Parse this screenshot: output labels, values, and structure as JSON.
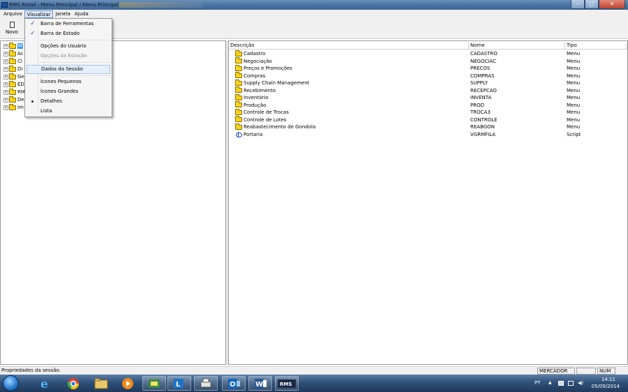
{
  "window": {
    "title": "RMS Retail - Menu Principal / Menu Principal",
    "minimize_glyph": "–",
    "maximize_glyph": "□",
    "close_glyph": "✕"
  },
  "menubar": {
    "items": [
      "Arquivo",
      "Visualizar",
      "Janela",
      "Ajuda"
    ],
    "active": "Visualizar"
  },
  "toolbar": {
    "new_label": "Novo"
  },
  "view_menu": {
    "items": [
      {
        "label": "Barra de Ferramentas",
        "mark": "✓",
        "enabled": true
      },
      {
        "label": "Barra de Estado",
        "mark": "✓",
        "enabled": true
      },
      {
        "label": "Opções do Usuário",
        "mark": "",
        "enabled": true
      },
      {
        "label": "Opções da Estação",
        "mark": "",
        "enabled": false
      },
      {
        "label": "Dados da Sessão",
        "mark": "",
        "enabled": true,
        "highlighted": true
      },
      {
        "label": "Ícones Pequenos",
        "mark": "",
        "enabled": true
      },
      {
        "label": "Ícones Grandes",
        "mark": "",
        "enabled": true
      },
      {
        "label": "Detalhes",
        "mark": "bullet",
        "enabled": true
      },
      {
        "label": "Lista",
        "mark": "",
        "enabled": true
      }
    ]
  },
  "tree": {
    "expand_glyph": "+",
    "items": [
      {
        "label": "M",
        "selected": true
      },
      {
        "label": "Ac"
      },
      {
        "label": "Cl"
      },
      {
        "label": "Di"
      },
      {
        "label": "Ge"
      },
      {
        "label": "ED"
      },
      {
        "label": "RM"
      },
      {
        "label": "De"
      },
      {
        "label": "Im"
      }
    ]
  },
  "list": {
    "columns": [
      "Descrição",
      "Nome",
      "Tipo"
    ],
    "rows": [
      {
        "descricao": "Cadastro",
        "nome": "CADASTRO",
        "tipo": "Menu",
        "icon": "folder-icon"
      },
      {
        "descricao": "Negociação",
        "nome": "NEGOCIAC",
        "tipo": "Menu",
        "icon": "folder-icon"
      },
      {
        "descricao": "Preços e Promoções",
        "nome": "PRECOS",
        "tipo": "Menu",
        "icon": "folder-icon"
      },
      {
        "descricao": "Compras",
        "nome": "COMPRAS",
        "tipo": "Menu",
        "icon": "folder-icon"
      },
      {
        "descricao": "Supply Chain Management",
        "nome": "SUPPLY",
        "tipo": "Menu",
        "icon": "folder-icon"
      },
      {
        "descricao": "Recebimento",
        "nome": "RECEPCAO",
        "tipo": "Menu",
        "icon": "folder-icon"
      },
      {
        "descricao": "Inventário",
        "nome": "INVENTA",
        "tipo": "Menu",
        "icon": "folder-icon"
      },
      {
        "descricao": "Produção",
        "nome": "PROD",
        "tipo": "Menu",
        "icon": "folder-icon"
      },
      {
        "descricao": "Controle de Trocas",
        "nome": "TROCA3",
        "tipo": "Menu",
        "icon": "folder-icon"
      },
      {
        "descricao": "Controle de Lotes",
        "nome": "CONTROLE",
        "tipo": "Menu",
        "icon": "folder-icon"
      },
      {
        "descricao": "Reabastecimento de Gondola",
        "nome": "REABGON",
        "tipo": "Menu",
        "icon": "folder-icon"
      },
      {
        "descricao": "Portaria",
        "nome": "VGRMFILA",
        "tipo": "Script",
        "icon": "script-icon"
      }
    ]
  },
  "statusbar": {
    "message": "Propriedades da sessão.",
    "user": "MERCADOR",
    "num": "NUM"
  },
  "taskbar": {
    "pinned": [
      "internet-explorer-icon",
      "chrome-icon",
      "file-explorer-icon",
      "media-player-icon",
      "app-icon",
      "lync-icon",
      "printer-app-icon",
      "outlook-icon",
      "word-icon",
      "rms-icon"
    ],
    "outlook_text": "O",
    "word_text": "W",
    "rms_text": "RMS",
    "tray": {
      "language": "PT",
      "time": "14:11",
      "date": "05/09/2014"
    }
  },
  "colors": {
    "titlebar": "#4a74a4",
    "selection": "#3399ff",
    "folder": "#f7d21a",
    "taskbar": "#2f5078"
  }
}
